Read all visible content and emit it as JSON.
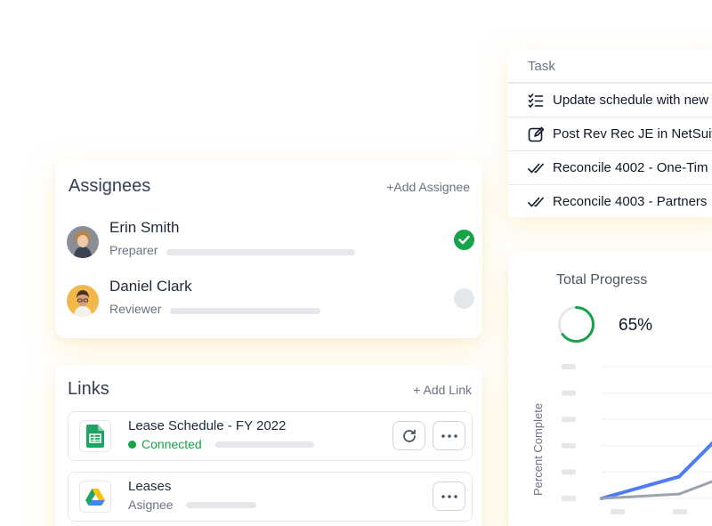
{
  "task_table": {
    "header": "Task",
    "rows": [
      {
        "label": "Update schedule with new",
        "icon": "checklist-icon"
      },
      {
        "label": "Post Rev Rec JE in NetSuit",
        "icon": "edit-icon"
      },
      {
        "label": "Reconcile 4002 - One-Tim",
        "icon": "double-check-icon"
      },
      {
        "label": "Reconcile 4003 - Partners",
        "icon": "double-check-icon"
      }
    ]
  },
  "assignees": {
    "title": "Assignees",
    "add_label": "+Add Assignee",
    "people": [
      {
        "name": "Erin Smith",
        "role": "Preparer",
        "status": "complete",
        "status_color": "#16a34a"
      },
      {
        "name": "Daniel Clark",
        "role": "Reviewer",
        "status": "pending",
        "status_color": "#e5e7eb"
      }
    ]
  },
  "links": {
    "title": "Links",
    "add_label": "+ Add Link",
    "items": [
      {
        "name": "Lease Schedule - FY 2022",
        "status": "Connected",
        "status_color": "#16a34a",
        "icon": "google-sheets-icon"
      },
      {
        "name": "Leases",
        "status": "Asignee",
        "icon": "google-drive-icon"
      }
    ]
  },
  "progress": {
    "title": "Total Progress",
    "percent_label": "65%",
    "percent": 65,
    "accent": "#16a34a"
  },
  "chart_data": {
    "type": "line",
    "title": "",
    "ylabel": "Percent Complete",
    "xlabel": "",
    "series": [
      {
        "values": [
          0,
          15,
          60
        ],
        "color": "#4f7cf5"
      },
      {
        "values": [
          0,
          3,
          20
        ],
        "color": "#9ca3af"
      }
    ]
  }
}
